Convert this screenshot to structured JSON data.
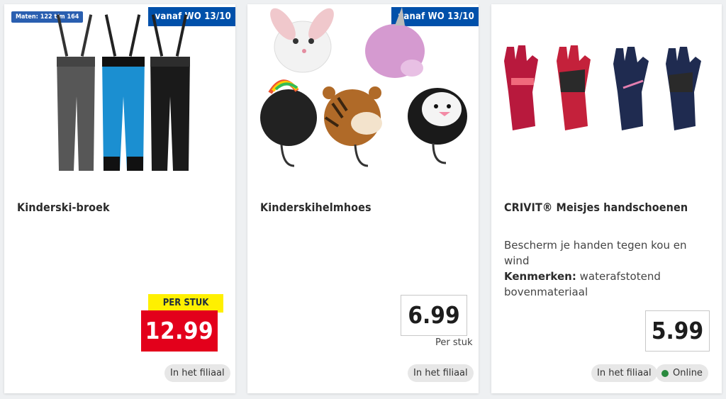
{
  "cards": [
    {
      "title": "Kinderski-broek",
      "badge_date": "vanaf WO 13/10",
      "badge_size": "Maten: 122 t/m 164",
      "price_label": "PER STUK",
      "price": "12.99",
      "availability": [
        "In het filiaal"
      ],
      "accent": "#e3001b",
      "image": "three ski pants with suspenders: grey, blue, black"
    },
    {
      "title": "Kinderskihelmhoes",
      "badge_date": "vanaf WO 13/10",
      "price": "6.99",
      "price_unit": "Per stuk",
      "availability": [
        "In het filiaal"
      ],
      "image": "five animal helmet covers: bunny, unicorn, rainbow mohawk, tiger, penguin"
    },
    {
      "title": "CRIVIT® Meisjes handschoenen",
      "description_line1": "Bescherm je handen tegen kou en wind",
      "description_label": "Kenmerken:",
      "description_line2": "waterafstotend bovenmateriaal",
      "price": "5.99",
      "availability": [
        "In het filiaal",
        "Online"
      ],
      "online_color": "#2a8a3e",
      "image": "four ski gloves: two red/pink, two navy"
    }
  ],
  "colors": {
    "brand_blue": "#0050aa",
    "price_yellow": "#fff000",
    "price_red": "#e3001b"
  }
}
